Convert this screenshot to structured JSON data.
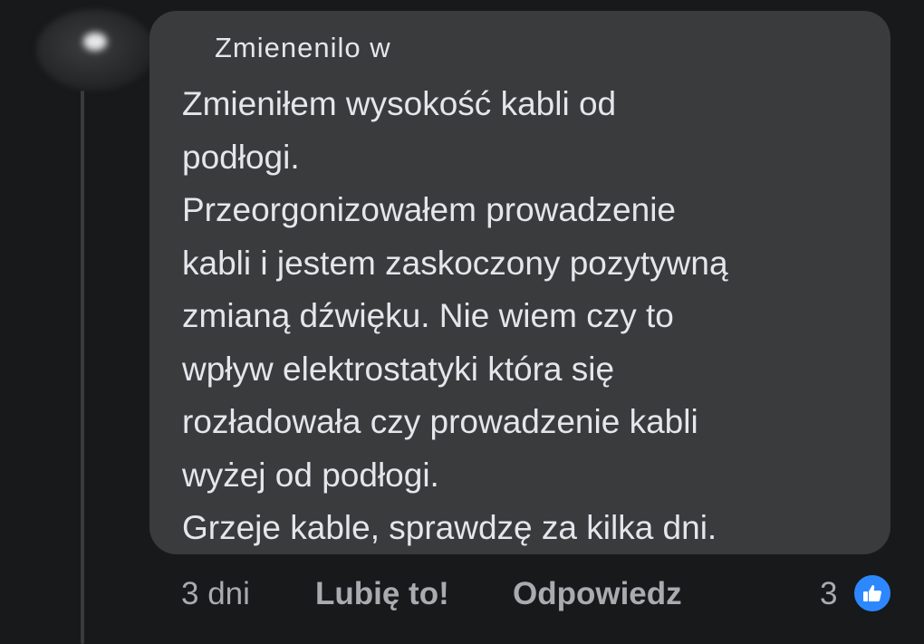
{
  "comment": {
    "author": "Zmienenilo w",
    "lines": [
      "Zmieniłem wysokość kabli od",
      "podłogi.",
      "Przeorgonizowałem prowadzenie",
      "kabli i jestem zaskoczony pozytywną",
      "zmianą dźwięku. Nie wiem czy to",
      "wpływ elektrostatyki która się",
      "rozładowała czy prowadzenie kabli",
      "wyżej od podłogi.",
      "Grzeje kable, sprawdzę za kilka dni."
    ]
  },
  "actions": {
    "time": "3 dni",
    "like_label": "Lubię to!",
    "reply_label": "Odpowiedz",
    "reaction_count": "3",
    "reaction_icon": "thumbs-up-icon"
  },
  "colors": {
    "background": "#18191a",
    "bubble": "#3a3b3c",
    "text": "#e4e6eb",
    "muted": "#a8abb0",
    "like_blue": "#2d88ff"
  }
}
